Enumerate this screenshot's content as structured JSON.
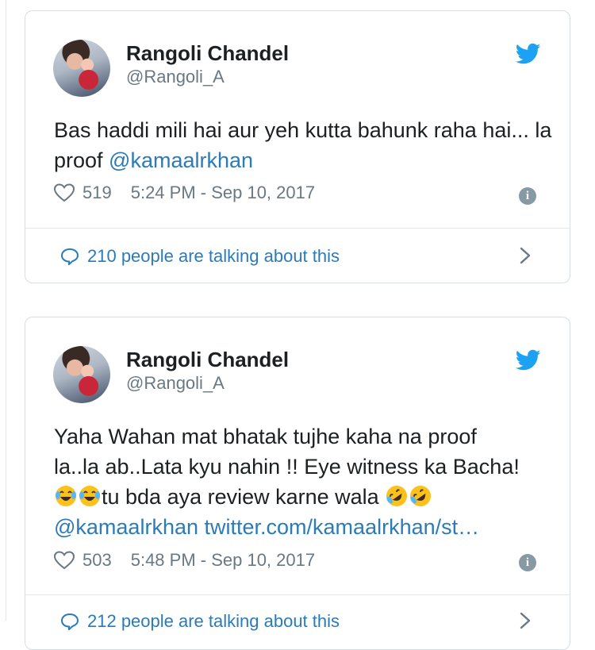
{
  "tweets": [
    {
      "author": "Rangoli Chandel",
      "handle": "@Rangoli_A",
      "text_before": "Bas haddi mili hai aur yeh kutta bahunk raha hai... la proof ",
      "mention": "@kamaalrkhan",
      "likes": "519",
      "timestamp": "5:24 PM - Sep 10, 2017",
      "talking": "210 people are talking about this"
    },
    {
      "author": "Rangoli Chandel",
      "handle": "@Rangoli_A",
      "line1": "Yaha Wahan mat bhatak tujhe kaha na proof",
      "line2": "la..la ab..Lata kyu nahin !! Eye witness ka Bacha!",
      "line3_text": "tu bda aya review karne wala ",
      "mention": "@kamaalrkhan",
      "link": "twitter.com/kamaalrkhan/st…",
      "likes": "503",
      "timestamp": "5:48 PM - Sep 10, 2017",
      "talking": "212 people are talking about this"
    }
  ],
  "icons": {
    "bird": "twitter-bird-icon",
    "heart": "heart-icon",
    "info": "info-icon",
    "bubble": "speech-bubble-icon",
    "chevron": "chevron-right-icon",
    "emoji_joy": "face-with-tears-of-joy",
    "emoji_rofl": "rolling-on-floor-laughing"
  },
  "colors": {
    "link": "#2b7bb9",
    "bird": "#1da1f2",
    "muted": "#697882",
    "border": "#d8dee3"
  }
}
